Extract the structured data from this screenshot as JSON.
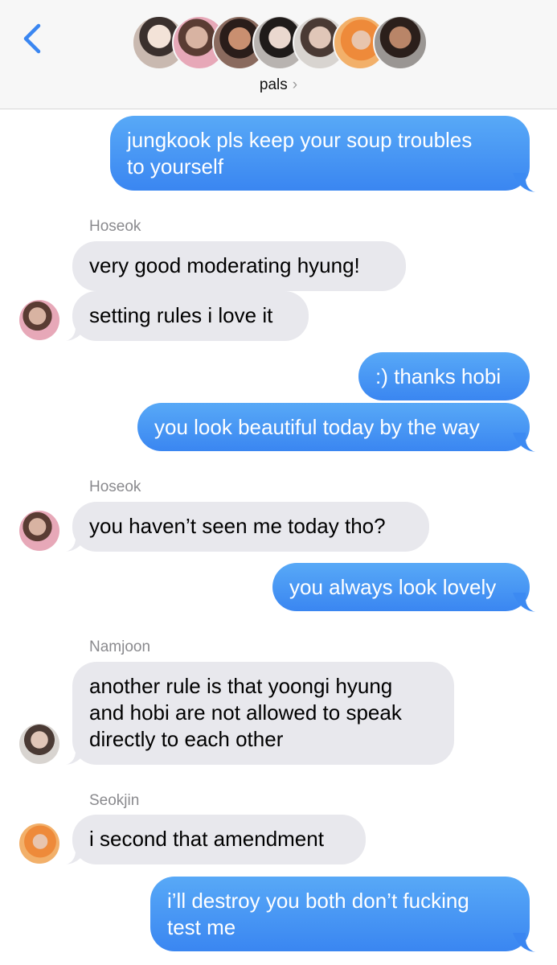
{
  "header": {
    "group_name": "pals",
    "chevron": "›",
    "back_icon": "chevron-left-icon",
    "member_count": 7
  },
  "colors": {
    "accent": "#3a86f1",
    "outgoing_bubble": "#4a98f4",
    "incoming_bubble": "#e8e8ed",
    "sender_label": "#8a8a8e"
  },
  "messages": [
    {
      "direction": "outgoing",
      "text_lines": [
        "jungkook pls keep your soup troubles",
        "to yourself"
      ]
    },
    {
      "direction": "incoming",
      "sender": "Hoseok",
      "text_lines": [
        "very good moderating hyung!"
      ]
    },
    {
      "direction": "incoming",
      "text_lines": [
        "setting rules i love it"
      ]
    },
    {
      "direction": "outgoing",
      "text_lines": [
        ":) thanks hobi"
      ]
    },
    {
      "direction": "outgoing",
      "text_lines": [
        "you look beautiful today by the way"
      ]
    },
    {
      "direction": "incoming",
      "sender": "Hoseok",
      "text_lines": [
        "you haven’t seen me today tho?"
      ]
    },
    {
      "direction": "outgoing",
      "text_lines": [
        "you always look lovely"
      ]
    },
    {
      "direction": "incoming",
      "sender": "Namjoon",
      "text_lines": [
        "another rule is that yoongi hyung",
        "and hobi are not allowed to speak",
        "directly to each other"
      ]
    },
    {
      "direction": "incoming",
      "sender": "Seokjin",
      "text_lines": [
        "i second that amendment"
      ]
    },
    {
      "direction": "outgoing",
      "text_lines": [
        "i’ll destroy you both don’t fucking",
        "test me"
      ]
    }
  ]
}
